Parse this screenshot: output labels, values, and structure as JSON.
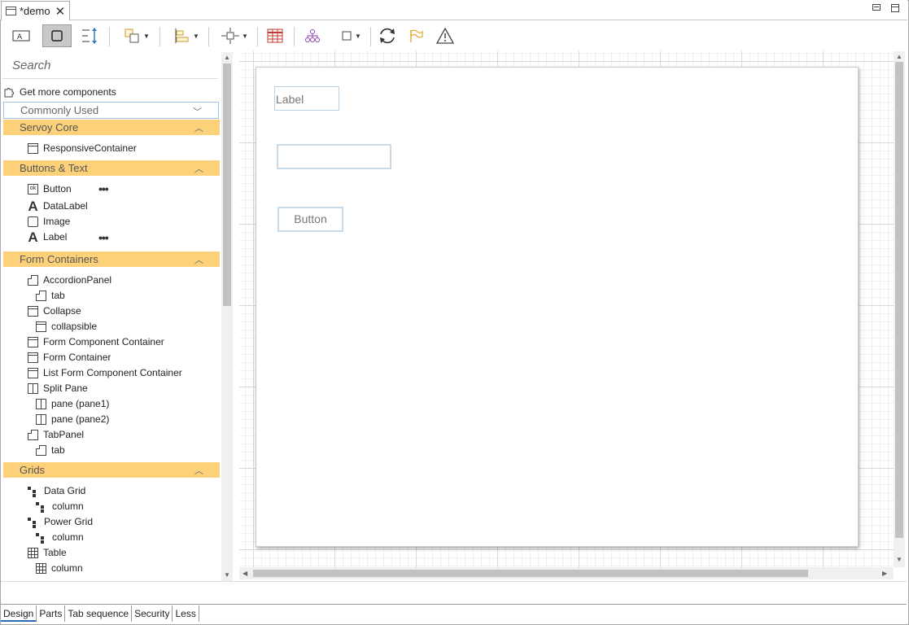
{
  "editor": {
    "tab_title": "*demo"
  },
  "toolbar": {
    "buttons": [
      "label-mode",
      "select-mode",
      "anchor-toggle",
      "group",
      "align",
      "distribute",
      "table-view",
      "hierarchy",
      "bounds",
      "refresh",
      "flag",
      "warning"
    ]
  },
  "palette": {
    "search_placeholder": "Search",
    "get_more": "Get more components",
    "filter_selected": "Commonly Used",
    "categories": [
      {
        "label": "Servoy Core"
      },
      {
        "label": "Buttons & Text"
      },
      {
        "label": "Form Containers"
      },
      {
        "label": "Grids"
      }
    ],
    "items": {
      "responsive_container": "ResponsiveContainer",
      "button": "Button",
      "datalabel": "DataLabel",
      "image": "Image",
      "label": "Label",
      "accordion_panel": "AccordionPanel",
      "accordion_tab": "tab",
      "collapse": "Collapse",
      "collapsible": "collapsible",
      "form_component_container": "Form Component Container",
      "form_container": "Form Container",
      "list_form_component_container": "List Form Component Container",
      "split_pane": "Split Pane",
      "pane1": "pane (pane1)",
      "pane2": "pane (pane2)",
      "tab_panel": "TabPanel",
      "tabpanel_tab": "tab",
      "data_grid": "Data Grid",
      "data_grid_column": "column",
      "power_grid": "Power Grid",
      "power_grid_column": "column",
      "table": "Table",
      "table_column": "column"
    },
    "more_dots": "•••"
  },
  "form": {
    "label_text": "Label",
    "input_value": "",
    "button_text": "Button"
  },
  "bottom_tabs": [
    "Design",
    "Parts",
    "Tab sequence",
    "Security",
    "Less"
  ]
}
